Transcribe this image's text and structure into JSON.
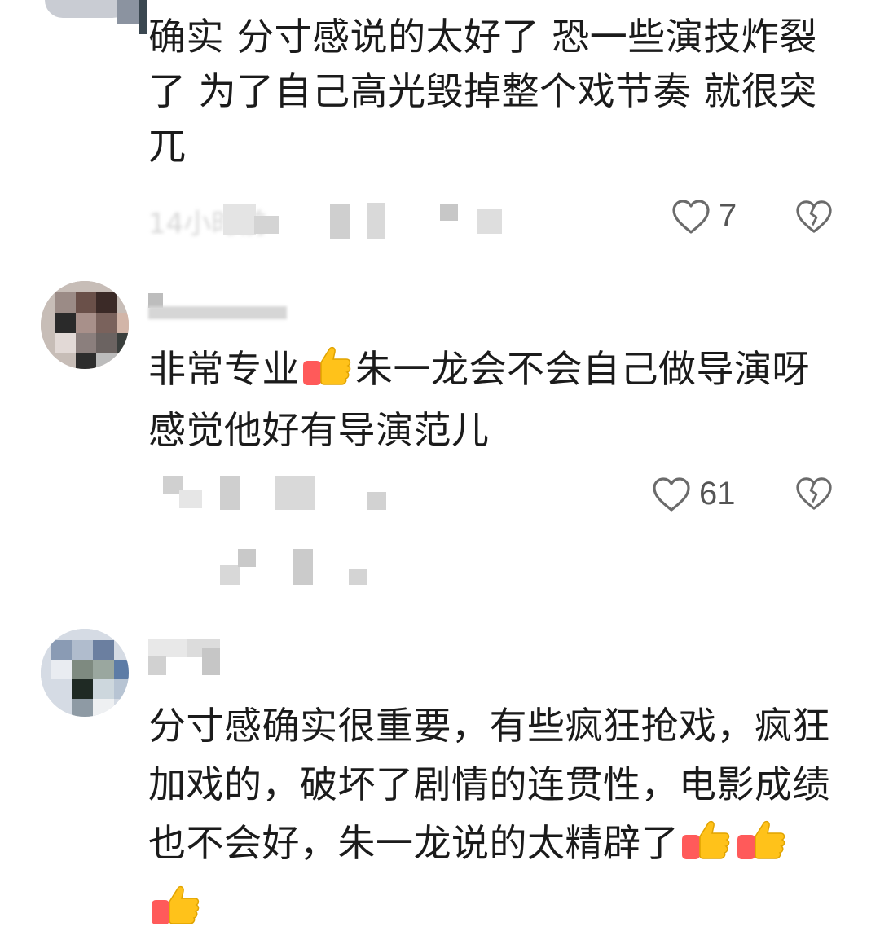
{
  "comments": [
    {
      "username": "",
      "text": "确实 分寸感说的太好了 恐一些演技炸裂了 为了自己高光毁掉整个戏节奏 就很突兀",
      "meta": "14小时前",
      "likes": "7"
    },
    {
      "username": "",
      "text_before": "非常专业",
      "text_after": "朱一龙会不会自己做导演呀 感觉他好有导演范儿",
      "likes": "61"
    },
    {
      "username": "",
      "text": "分寸感确实很重要，有些疯狂抢戏，疯狂加戏的，破坏了剧情的连贯性，电影成绩也不会好，朱一龙说的太精辟了"
    }
  ],
  "icons": {
    "like": "heart-outline-icon",
    "dislike": "broken-heart-icon",
    "emoji": "thumbs-up-emoji"
  },
  "colors": {
    "text": "#1b1b1b",
    "meta": "#b5b5b5",
    "icon": "#6b6b6b",
    "thumb_yellow": "#ffc21a",
    "thumb_sleeve": "#ff5a5a"
  }
}
